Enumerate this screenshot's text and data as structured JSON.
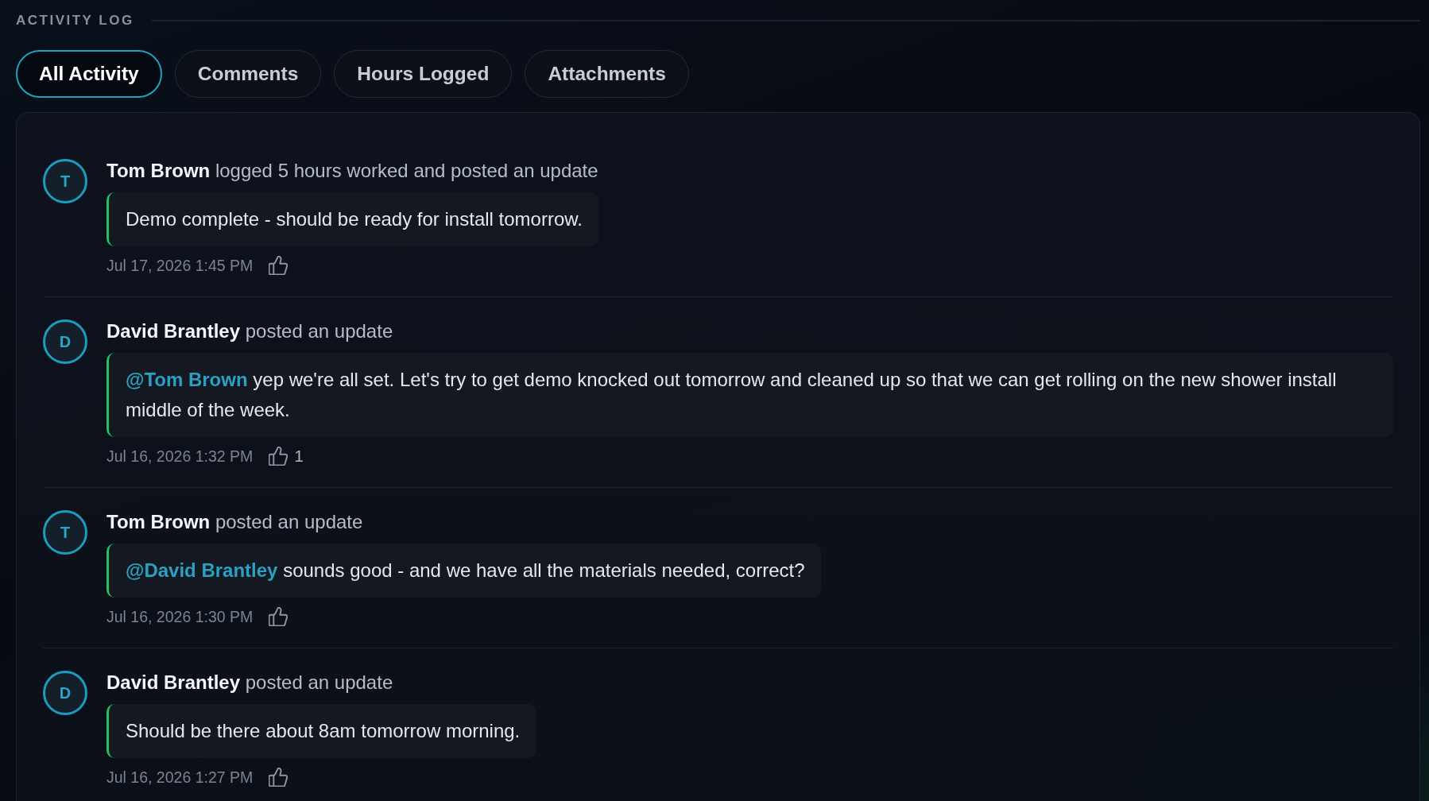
{
  "section": {
    "title": "ACTIVITY LOG"
  },
  "tabs": [
    {
      "label": "All Activity",
      "selected": true
    },
    {
      "label": "Comments",
      "selected": false
    },
    {
      "label": "Hours Logged",
      "selected": false
    },
    {
      "label": "Attachments",
      "selected": false
    }
  ],
  "activities": [
    {
      "avatar_initial": "T",
      "author": "Tom Brown",
      "action": "logged 5 hours worked and posted an update",
      "message": {
        "text": "Demo complete - should be ready for install tomorrow."
      },
      "timestamp": "Jul 17, 2026 1:45 PM"
    },
    {
      "avatar_initial": "D",
      "author": "David Brantley",
      "action": "posted an update",
      "message": {
        "mention": "@Tom Brown",
        "text": "yep we're all set. Let's try to get demo knocked out tomorrow and cleaned up so that we can get rolling on the new shower install middle of the week."
      },
      "timestamp": "Jul 16, 2026 1:32 PM",
      "likes": "1"
    },
    {
      "avatar_initial": "T",
      "author": "Tom Brown",
      "action": "posted an update",
      "message": {
        "mention": "@David Brantley",
        "text": "sounds good - and we have all the materials needed, correct?"
      },
      "timestamp": "Jul 16, 2026 1:30 PM"
    },
    {
      "avatar_initial": "D",
      "author": "David Brantley",
      "action": "posted an update",
      "message": {
        "text": "Should be there about 8am tomorrow morning."
      },
      "timestamp": "Jul 16, 2026 1:27 PM"
    }
  ]
}
